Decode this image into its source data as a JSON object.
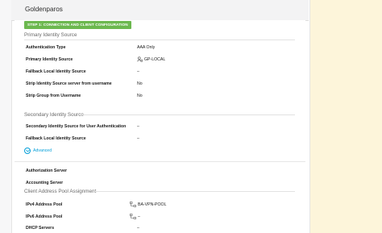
{
  "header": {
    "title": "Goldenparos"
  },
  "step_badge": "STEP 1: CONNECTION AND CLIENT CONFIGURATION",
  "sections": {
    "primary": {
      "title": "Primary Identity Source",
      "rows": [
        {
          "label": "Authentication Type",
          "value": "AAA Only"
        },
        {
          "label": "Primary Identity Source",
          "value": "GP-LOCAL",
          "icon": "identity-source-icon"
        },
        {
          "label": "Fallback Local Identity Source",
          "value": "–"
        },
        {
          "label": "Strip Identity Source server from username",
          "value": "No"
        },
        {
          "label": "Strip Group from Username",
          "value": "No"
        }
      ]
    },
    "secondary": {
      "title": "Secondary Identity Source",
      "rows": [
        {
          "label": "Secondary Identity Source for User Authentication",
          "value": "–"
        },
        {
          "label": "Fallback Local Identity Source",
          "value": "–"
        }
      ],
      "advanced_label": "Advanced"
    },
    "servers": {
      "rows": [
        {
          "label": "Authorization Server",
          "value": ""
        },
        {
          "label": "Accounting Server",
          "value": ""
        }
      ]
    },
    "pool": {
      "title": "Client Address Pool Assignment",
      "rows": [
        {
          "label": "IPv4 Address Pool",
          "value": "BA-VPN-POOL",
          "icon": "network-pool-icon"
        },
        {
          "label": "IPv6 Address Pool",
          "value": "–",
          "icon": "network-pool-icon"
        },
        {
          "label": "DHCP Servers",
          "value": "–"
        }
      ]
    }
  },
  "colors": {
    "badge": "#6cb84f",
    "link": "#049fd9",
    "right_strip": "#fdf5da"
  }
}
